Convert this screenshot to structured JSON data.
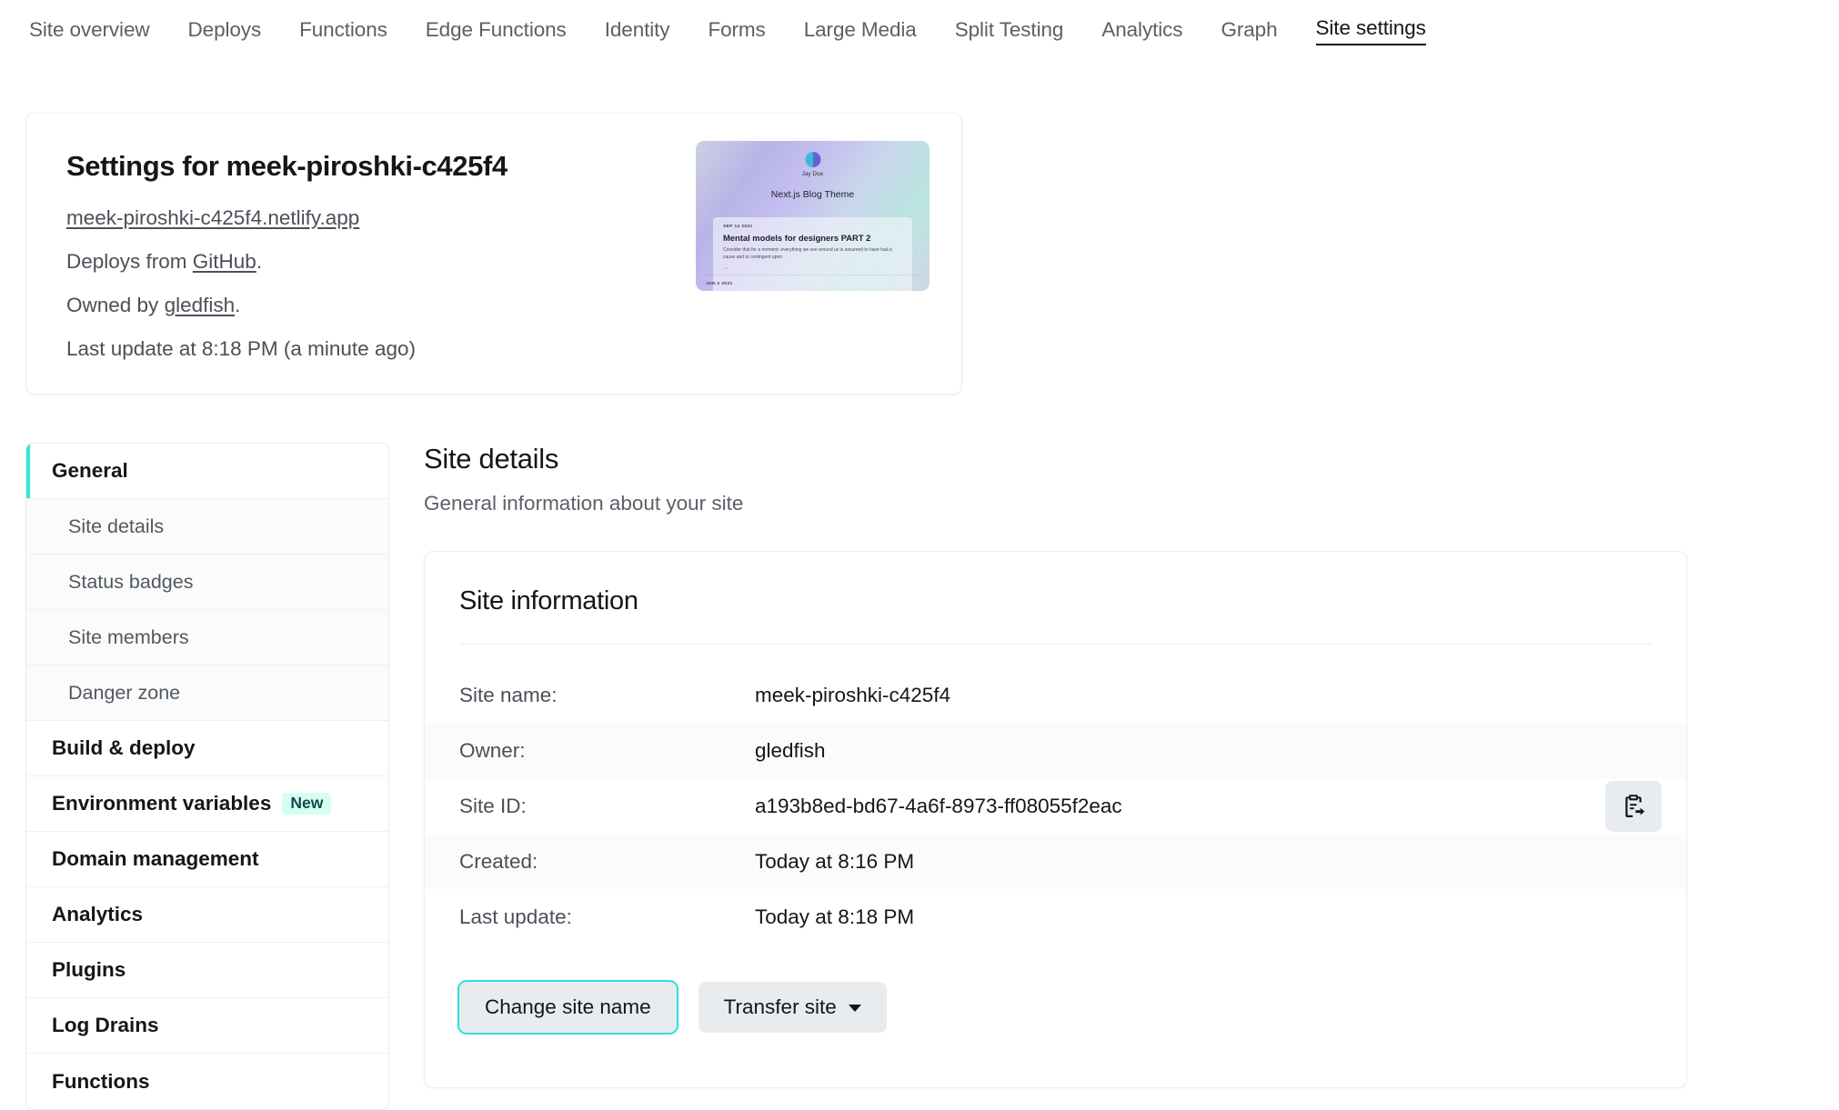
{
  "topnav": {
    "items": [
      {
        "label": "Site overview",
        "active": false
      },
      {
        "label": "Deploys",
        "active": false
      },
      {
        "label": "Functions",
        "active": false
      },
      {
        "label": "Edge Functions",
        "active": false
      },
      {
        "label": "Identity",
        "active": false
      },
      {
        "label": "Forms",
        "active": false
      },
      {
        "label": "Large Media",
        "active": false
      },
      {
        "label": "Split Testing",
        "active": false
      },
      {
        "label": "Analytics",
        "active": false
      },
      {
        "label": "Graph",
        "active": false
      },
      {
        "label": "Site settings",
        "active": true
      }
    ]
  },
  "summary": {
    "title": "Settings for meek-piroshki-c425f4",
    "site_url": "meek-piroshki-c425f4.netlify.app",
    "deploys_prefix": "Deploys from ",
    "deploys_source": "GitHub",
    "deploys_suffix": ".",
    "owned_prefix": "Owned by ",
    "owner": "gledfish",
    "owned_suffix": ".",
    "last_update": "Last update at 8:18 PM (a minute ago)"
  },
  "thumbnail": {
    "author": "Jay Doe",
    "heading": "Next.js Blog Theme",
    "post_date": "SEP 14 2021",
    "post_title": "Mental models for designers PART 2",
    "post_excerpt": "Consider that for a moment: everything we see around us is assumed to have had a cause and is contingent upon.",
    "post_arrow": "→",
    "next_date": "JUN 2 2021"
  },
  "sidebar": {
    "items": [
      {
        "label": "General",
        "type": "group",
        "active": true
      },
      {
        "label": "Site details",
        "type": "sub"
      },
      {
        "label": "Status badges",
        "type": "sub"
      },
      {
        "label": "Site members",
        "type": "sub"
      },
      {
        "label": "Danger zone",
        "type": "sub"
      },
      {
        "label": "Build & deploy",
        "type": "group"
      },
      {
        "label": "Environment variables",
        "type": "group",
        "badge": "New"
      },
      {
        "label": "Domain management",
        "type": "group"
      },
      {
        "label": "Analytics",
        "type": "group"
      },
      {
        "label": "Plugins",
        "type": "group"
      },
      {
        "label": "Log Drains",
        "type": "group"
      },
      {
        "label": "Functions",
        "type": "group"
      }
    ]
  },
  "main": {
    "title": "Site details",
    "subtitle": "General information about your site",
    "card": {
      "title": "Site information",
      "rows": [
        {
          "label": "Site name:",
          "value": "meek-piroshki-c425f4",
          "copy": false
        },
        {
          "label": "Owner:",
          "value": "gledfish",
          "copy": false
        },
        {
          "label": "Site ID:",
          "value": "a193b8ed-bd67-4a6f-8973-ff08055f2eac",
          "copy": true
        },
        {
          "label": "Created:",
          "value": "Today at 8:16 PM",
          "copy": false
        },
        {
          "label": "Last update:",
          "value": "Today at 8:18 PM",
          "copy": false
        }
      ],
      "buttons": [
        {
          "label": "Change site name",
          "focused": true,
          "chevron": false
        },
        {
          "label": "Transfer site",
          "focused": false,
          "chevron": true
        }
      ]
    }
  },
  "colors": {
    "accent_teal": "#32e6e2",
    "badge_bg": "#d6fff4",
    "badge_text": "#11494c",
    "button_bg": "#e9ecef",
    "text_primary": "#14161a",
    "text_muted": "#5c6068"
  }
}
